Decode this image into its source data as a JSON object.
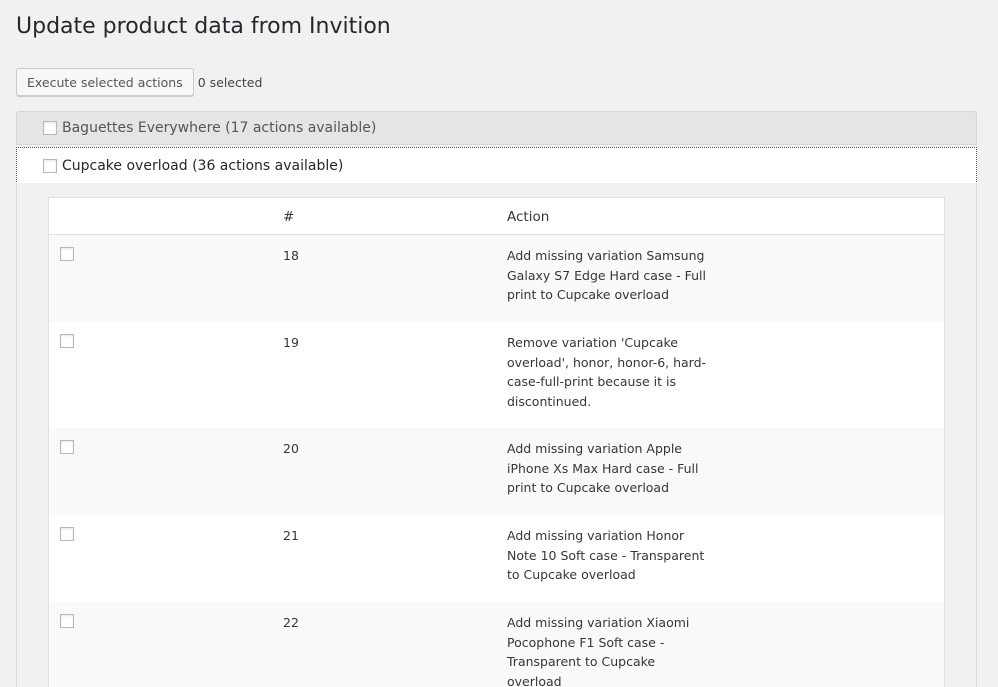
{
  "page": {
    "title": "Update product data from Invition"
  },
  "toolbar": {
    "execute_label": "Execute selected actions",
    "selected_count": "0 selected"
  },
  "groups": [
    {
      "label": "Baguettes Everywhere (17 actions available)",
      "expanded": false
    },
    {
      "label": "Cupcake overload (36 actions available)",
      "expanded": true
    }
  ],
  "table": {
    "columns": [
      "",
      "#",
      "Action"
    ],
    "rows": [
      {
        "num": "18",
        "action": "Add missing variation Samsung Galaxy S7 Edge Hard case - Full print to Cupcake overload"
      },
      {
        "num": "19",
        "action": "Remove variation 'Cupcake overload', honor, honor-6, hard-case-full-print because it is discontinued."
      },
      {
        "num": "20",
        "action": "Add missing variation Apple iPhone Xs Max Hard case - Full print to Cupcake overload"
      },
      {
        "num": "21",
        "action": "Add missing variation Honor Note 10 Soft case - Transparent to Cupcake overload"
      },
      {
        "num": "22",
        "action": "Add missing variation Xiaomi Pocophone F1 Soft case - Transparent to Cupcake overload"
      }
    ]
  },
  "colors": {
    "background": "#f1f1f1",
    "collapsed_group": "#e5e5e5",
    "row_stripe": "#f9f9f9",
    "text": "#23282d"
  }
}
